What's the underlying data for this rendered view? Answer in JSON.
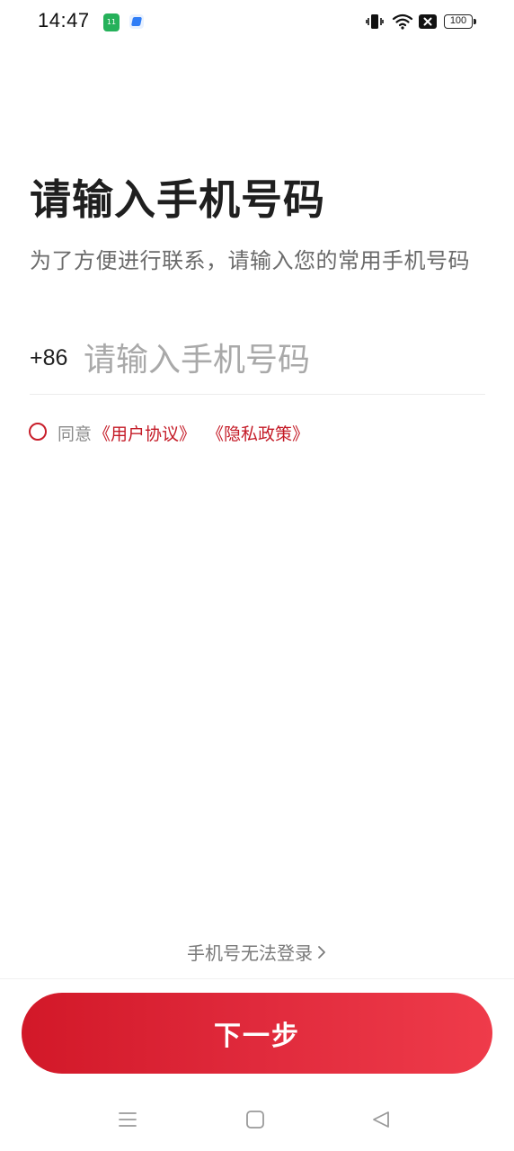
{
  "status_bar": {
    "time": "14:47",
    "battery": "100",
    "app_icon_green_text": "11"
  },
  "page": {
    "title": "请输入手机号码",
    "subtitle": "为了方便进行联系，请输入您的常用手机号码"
  },
  "phone": {
    "country_code": "+86",
    "placeholder": "请输入手机号码",
    "value": ""
  },
  "agreement": {
    "checked": false,
    "prefix": "同意",
    "user_agreement": "《用户协议》",
    "privacy_policy": "《隐私政策》"
  },
  "footer": {
    "cant_login": "手机号无法登录",
    "next_button": "下一步"
  },
  "colors": {
    "accent": "#c41a26",
    "button_gradient_start": "#d21828",
    "button_gradient_end": "#ef3b4a"
  },
  "icons": {
    "vibrate": "vibrate-icon",
    "wifi": "wifi-icon",
    "no_sim": "no-sim-icon",
    "battery": "battery-icon",
    "nav_menu": "menu-icon",
    "nav_home": "home-icon",
    "nav_back": "back-icon"
  }
}
